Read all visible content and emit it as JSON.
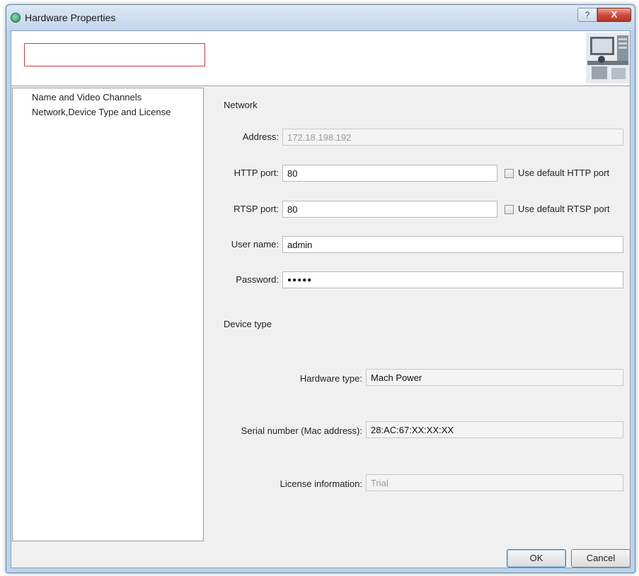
{
  "window": {
    "title": "Hardware Properties",
    "help_label": "?",
    "close_label": "X"
  },
  "icons": {
    "app": "hardware-properties-app-icon",
    "help": "question-mark-icon",
    "close": "close-x-icon",
    "banner": "hardware-room-illustration"
  },
  "nav": {
    "items": [
      {
        "label": "Name and Video Channels"
      },
      {
        "label": "Network,Device Type and License"
      }
    ],
    "highlight_color": "#d43a3a"
  },
  "network": {
    "header": "Network",
    "address": {
      "label": "Address:",
      "value": "172.18.198.192"
    },
    "http_port": {
      "label": "HTTP port:",
      "value": "80",
      "checkbox_label": "Use default HTTP port",
      "checked": false
    },
    "rtsp_port": {
      "label": "RTSP port:",
      "value": "80",
      "checkbox_label": "Use default RTSP port",
      "checked": false
    },
    "user_name": {
      "label": "User name:",
      "value": "admin"
    },
    "password": {
      "label": "Password:",
      "value": "●●●●●"
    }
  },
  "device_type": {
    "header": "Device type",
    "hardware_type": {
      "label": "Hardware type:",
      "value": "Mach Power"
    },
    "serial_number": {
      "label": "Serial number (Mac address):",
      "value": "28:AC:67:XX:XX:XX"
    },
    "license": {
      "label": "License information:",
      "value": "Trial"
    }
  },
  "buttons": {
    "ok": "OK",
    "cancel": "Cancel"
  }
}
